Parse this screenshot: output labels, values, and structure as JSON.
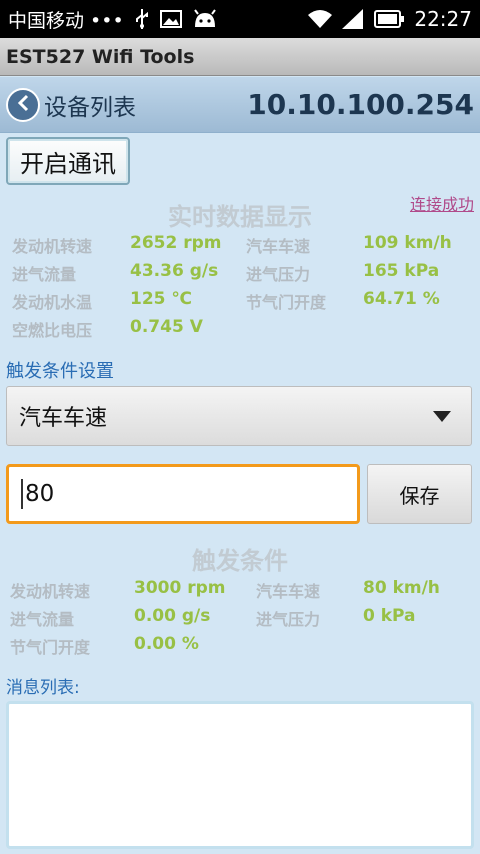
{
  "status_bar": {
    "carrier": "中国移动 •••",
    "icons": [
      "usb-icon",
      "image-icon",
      "android-icon",
      "wifi-icon",
      "signal-icon",
      "battery-icon"
    ],
    "time": "22:27"
  },
  "app": {
    "title": "EST527 Wifi Tools"
  },
  "header": {
    "back_label": "设备列表",
    "ip": "10.10.100.254"
  },
  "controls": {
    "start_button": "开启通讯",
    "connection_status": "连接成功"
  },
  "realtime": {
    "title": "实时数据显示",
    "rows": [
      {
        "l1": "发动机转速",
        "v1": "2652 rpm",
        "l2": "汽车车速",
        "v2": "109 km/h"
      },
      {
        "l1": "进气流量",
        "v1": "43.36 g/s",
        "l2": "进气压力",
        "v2": "165 kPa"
      },
      {
        "l1": "发动机水温",
        "v1": "125 ℃",
        "l2": "节气门开度",
        "v2": "64.71 %"
      },
      {
        "l1": "空燃比电压",
        "v1": "0.745 V"
      }
    ]
  },
  "trigger": {
    "section_label": "触发条件设置",
    "selected_option": "汽车车速",
    "input_value": "80",
    "save_button": "保存"
  },
  "trigger_conditions": {
    "title": "触发条件",
    "rows": [
      {
        "l1": "发动机转速",
        "v1": "3000 rpm",
        "l2": "汽车车速",
        "v2": "80  km/h"
      },
      {
        "l1": "进气流量",
        "v1": "0.00 g/s",
        "l2": "进气压力",
        "v2": "0 kPa"
      },
      {
        "l1": "节气门开度",
        "v1": "0.00 %"
      }
    ]
  },
  "messages": {
    "label": "消息列表:"
  },
  "colors": {
    "accent_value": "#98c045",
    "link": "#b04a8a",
    "input_focus": "#f39a1b",
    "section_blue": "#2a6db4"
  }
}
